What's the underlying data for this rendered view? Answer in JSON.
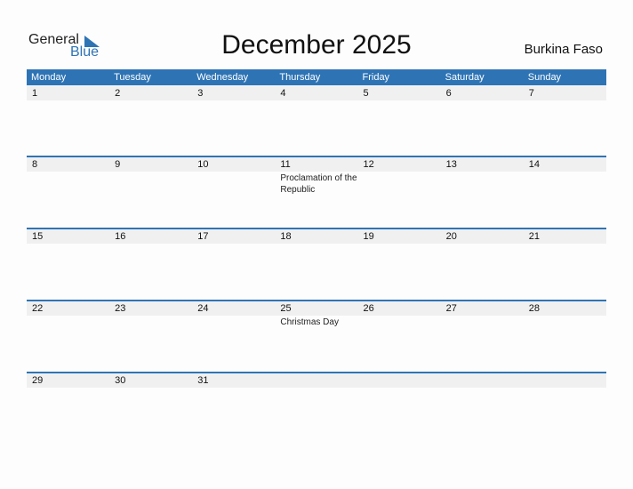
{
  "logo": {
    "general": "General",
    "blue": "Blue"
  },
  "title": "December 2025",
  "country": "Burkina Faso",
  "colors": {
    "accent": "#2e74b5",
    "row_bg": "#f0f0f0"
  },
  "weekdays": [
    "Monday",
    "Tuesday",
    "Wednesday",
    "Thursday",
    "Friday",
    "Saturday",
    "Sunday"
  ],
  "weeks": [
    [
      {
        "d": "1"
      },
      {
        "d": "2"
      },
      {
        "d": "3"
      },
      {
        "d": "4"
      },
      {
        "d": "5"
      },
      {
        "d": "6"
      },
      {
        "d": "7"
      }
    ],
    [
      {
        "d": "8"
      },
      {
        "d": "9"
      },
      {
        "d": "10"
      },
      {
        "d": "11",
        "h": "Proclamation of the Republic"
      },
      {
        "d": "12"
      },
      {
        "d": "13"
      },
      {
        "d": "14"
      }
    ],
    [
      {
        "d": "15"
      },
      {
        "d": "16"
      },
      {
        "d": "17"
      },
      {
        "d": "18"
      },
      {
        "d": "19"
      },
      {
        "d": "20"
      },
      {
        "d": "21"
      }
    ],
    [
      {
        "d": "22"
      },
      {
        "d": "23"
      },
      {
        "d": "24"
      },
      {
        "d": "25",
        "h": "Christmas Day"
      },
      {
        "d": "26"
      },
      {
        "d": "27"
      },
      {
        "d": "28"
      }
    ],
    [
      {
        "d": "29"
      },
      {
        "d": "30"
      },
      {
        "d": "31"
      },
      {
        "d": ""
      },
      {
        "d": ""
      },
      {
        "d": ""
      },
      {
        "d": ""
      }
    ]
  ]
}
